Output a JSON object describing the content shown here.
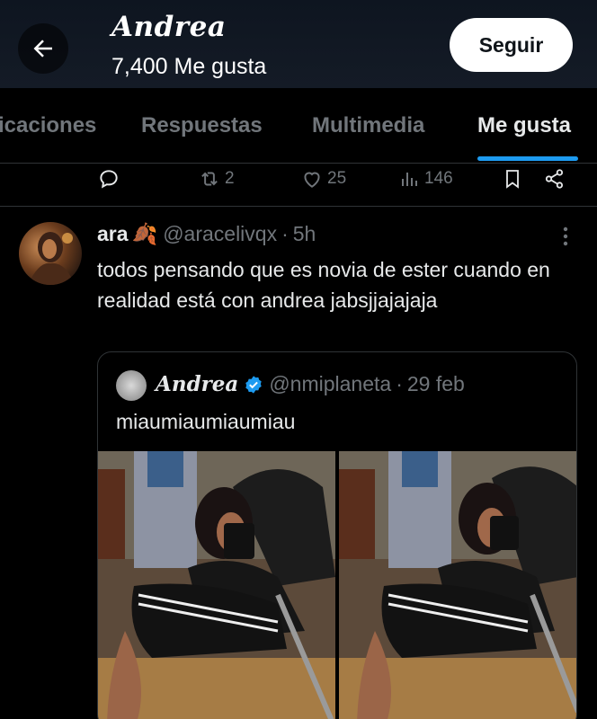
{
  "header": {
    "title": "Andrea",
    "subtitle": "7,400 Me gusta",
    "follow_label": "Seguir"
  },
  "tabs": [
    {
      "label": "icaciones"
    },
    {
      "label": "Respuestas"
    },
    {
      "label": "Multimedia"
    },
    {
      "label": "Me gusta"
    }
  ],
  "actions": {
    "retweets": "2",
    "likes": "25",
    "views": "146"
  },
  "tweet": {
    "name": "ara",
    "emoji": "🍂",
    "handle": "@aracelivqx",
    "dot": "·",
    "time": "5h",
    "text": "todos pensando que es novia de ester cuando en realidad está con andrea jabsjjajajaja"
  },
  "quote": {
    "name": "Andrea",
    "handle": "@nmiplaneta",
    "dot": "·",
    "time": "29 feb",
    "text": "miaumiaumiaumiau"
  },
  "colors": {
    "accent": "#1d9bf0",
    "muted": "#71767b",
    "text": "#e7e9ea",
    "border": "#2f3336"
  }
}
